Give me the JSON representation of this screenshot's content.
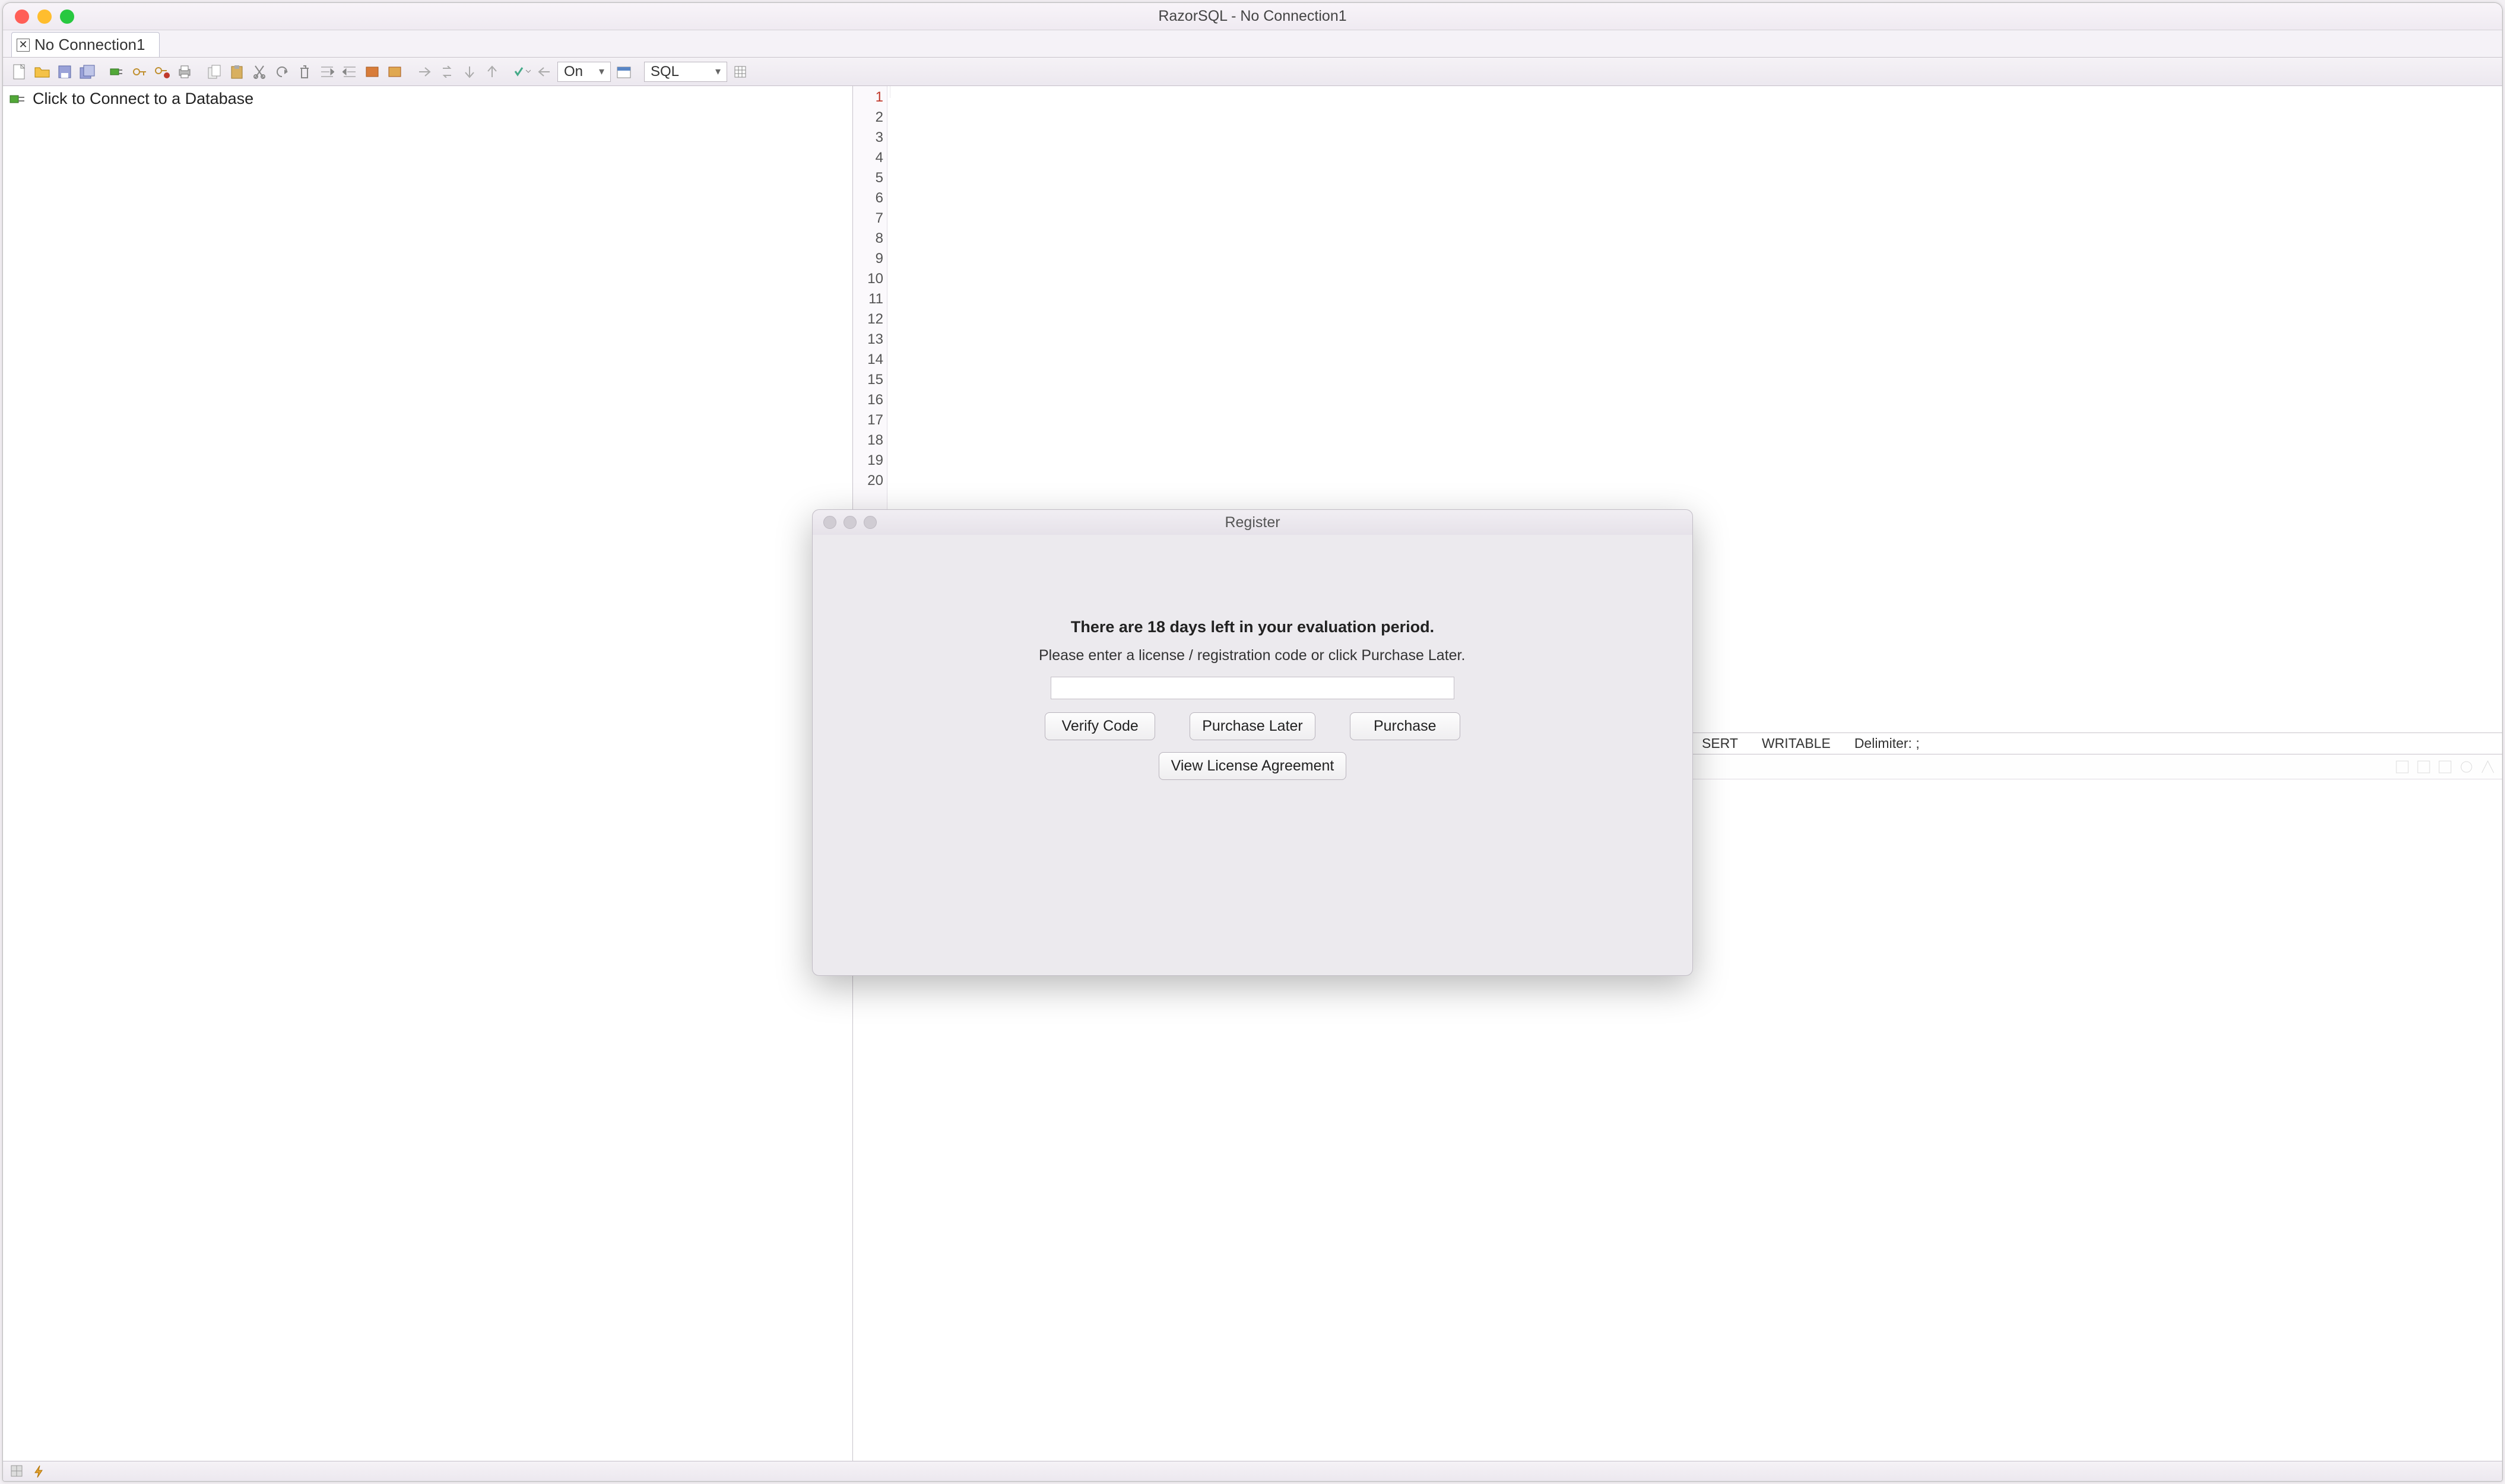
{
  "window": {
    "title": "RazorSQL - No Connection1"
  },
  "tab": {
    "label": "No Connection1"
  },
  "toolbar": {
    "toggle": "On",
    "sql": "SQL"
  },
  "sidebar": {
    "connect_text": "Click to Connect to a Database"
  },
  "editor": {
    "line_count": 20
  },
  "status": {
    "mode": "SERT",
    "writable": "WRITABLE",
    "delimiter": "Delimiter: ;"
  },
  "modal": {
    "title": "Register",
    "heading": "There are 18 days left in your evaluation period.",
    "body": "Please enter a license / registration code or click Purchase Later.",
    "buttons": {
      "verify": "Verify Code",
      "later": "Purchase Later",
      "purchase": "Purchase",
      "license": "View License Agreement"
    }
  }
}
